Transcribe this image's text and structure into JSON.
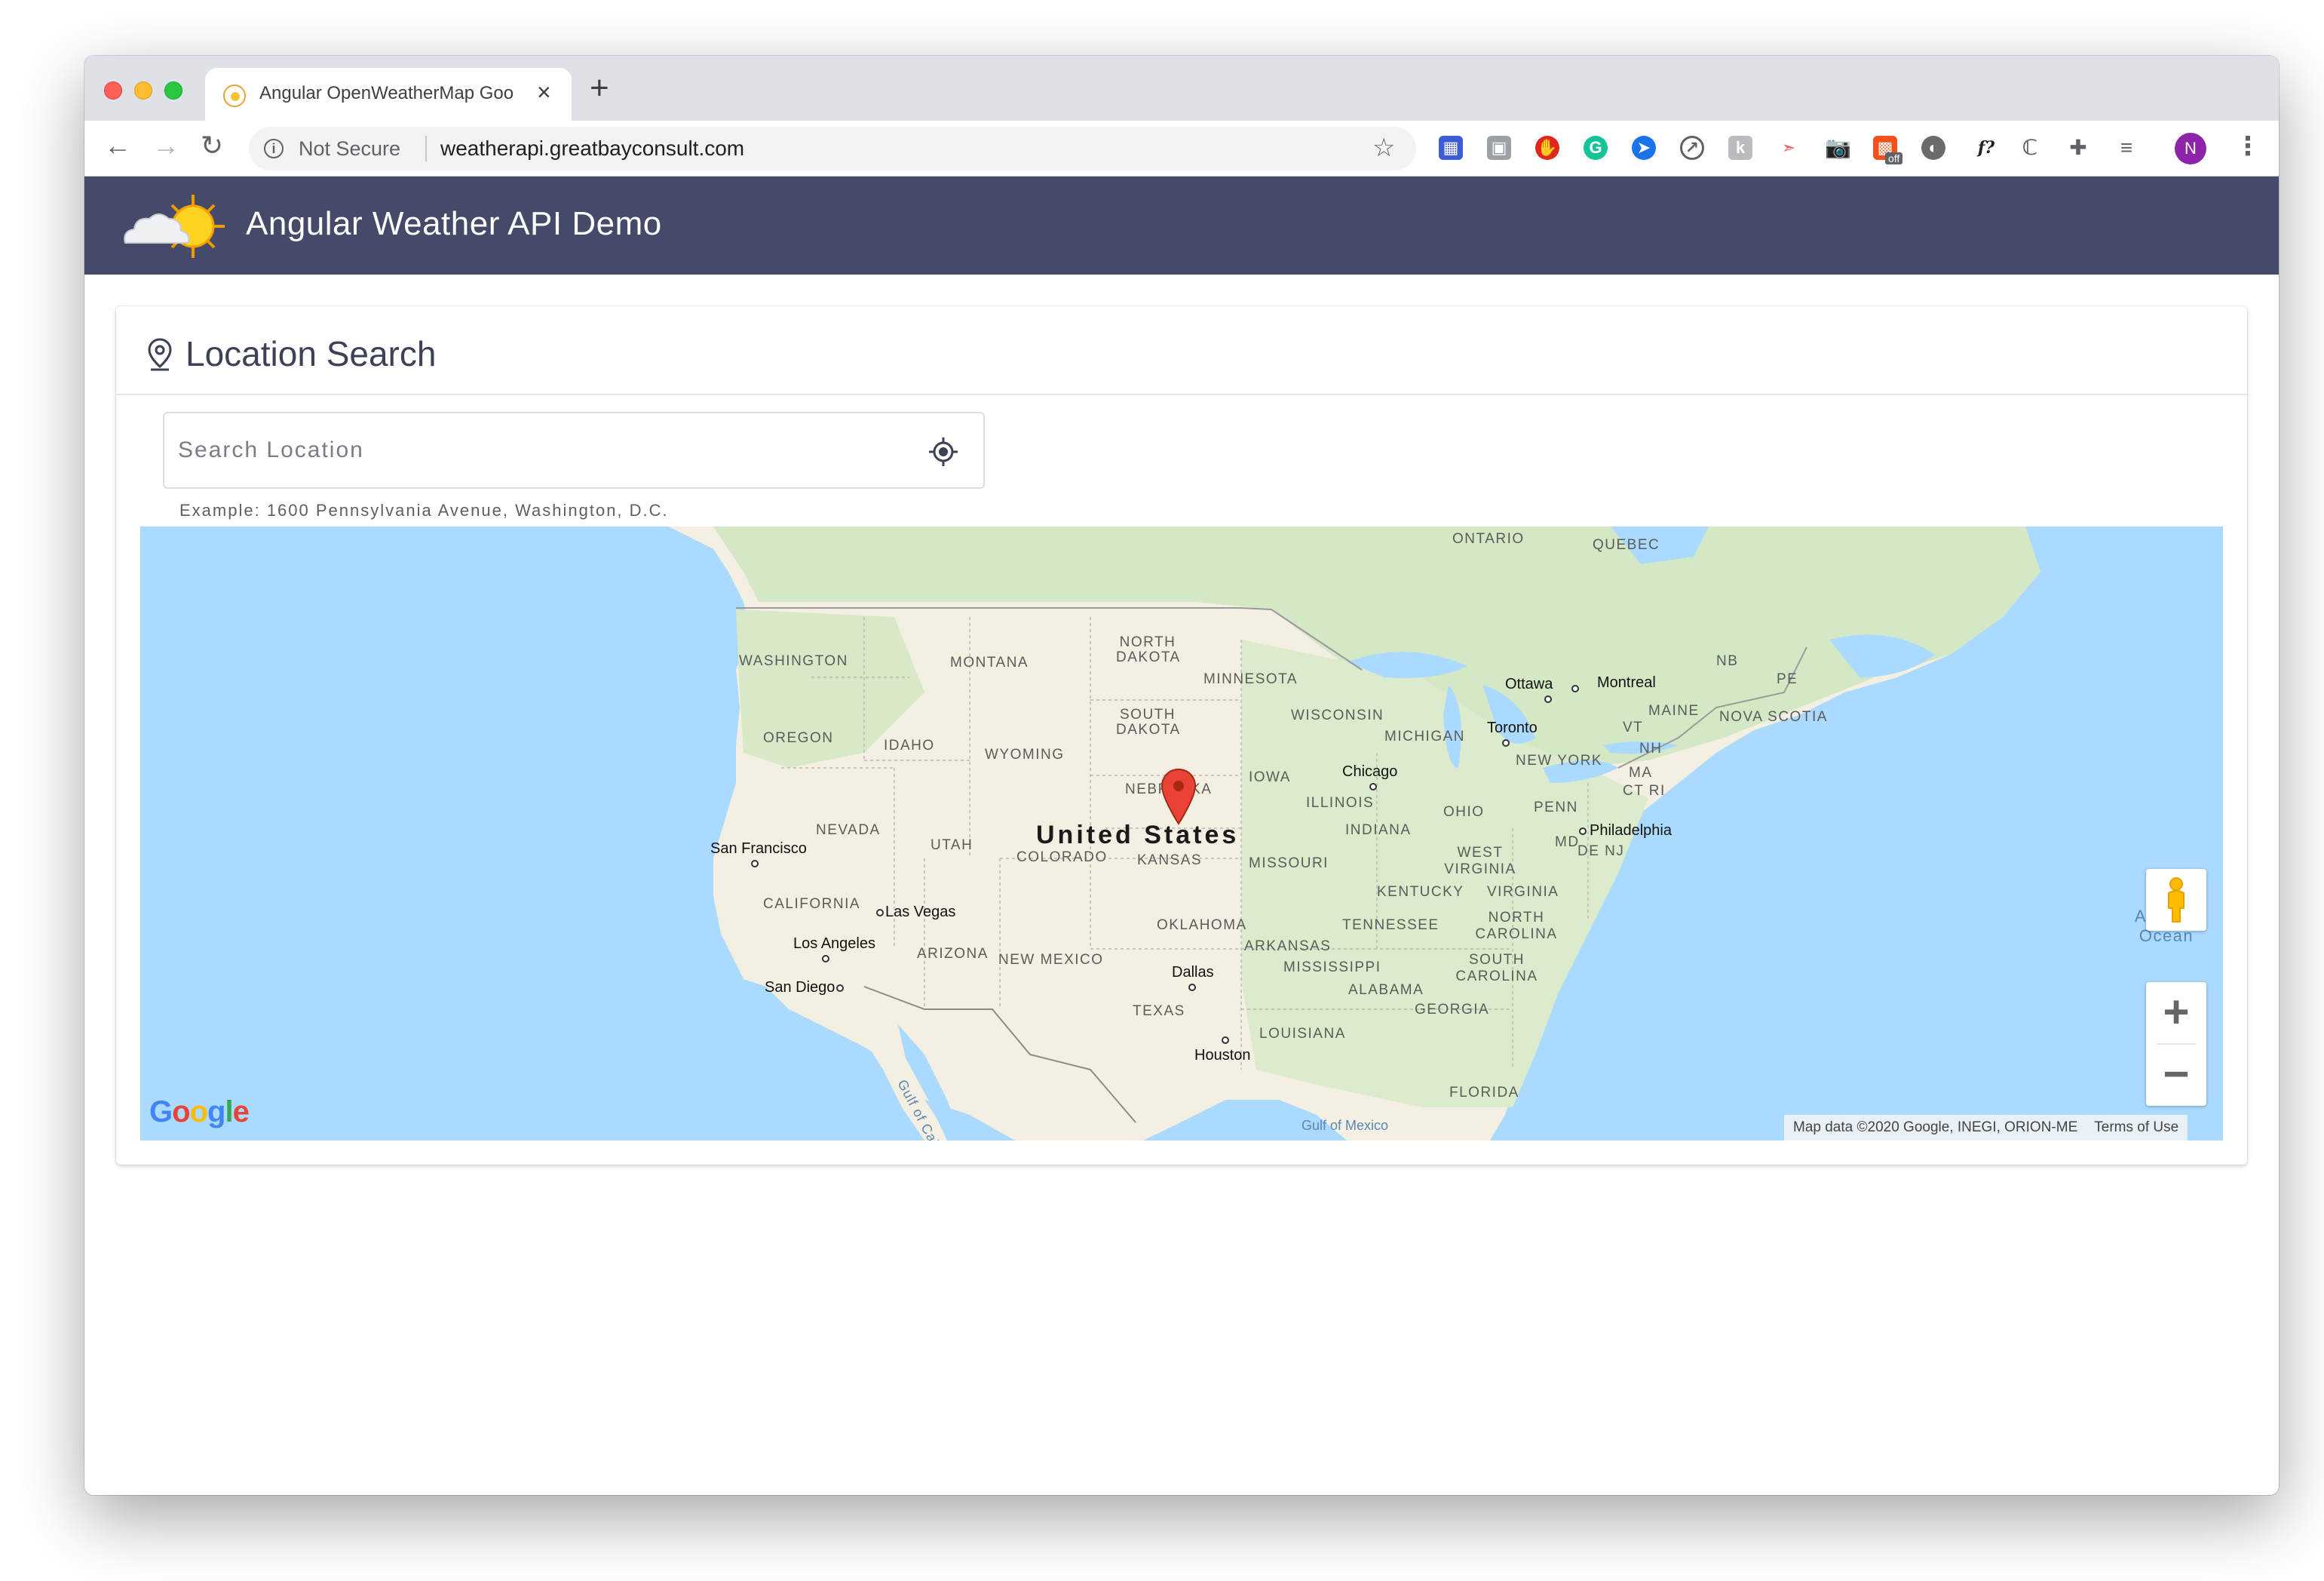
{
  "browser": {
    "tab_title": "Angular OpenWeatherMap Goo",
    "new_tab": "+",
    "close": "×",
    "security": "Not Secure",
    "url": "weatherapi.greatbayconsult.com",
    "avatar_initial": "N",
    "extension_off_badge": "off",
    "extension_f_label": "f?"
  },
  "app": {
    "title": "Angular Weather API Demo"
  },
  "card": {
    "title": "Location Search",
    "search_placeholder": "Search Location",
    "search_value": "",
    "hint": "Example: 1600 Pennsylvania Avenue, Washington, D.C."
  },
  "map": {
    "country": "United States",
    "regions": [
      "ONTARIO",
      "QUEBEC",
      "WASHINGTON",
      "MONTANA",
      "NORTH DAKOTA",
      "MINNESOTA",
      "OREGON",
      "IDAHO",
      "SOUTH DAKOTA",
      "WYOMING",
      "WISCONSIN",
      "MICHIGAN",
      "NEBRASKA",
      "IOWA",
      "NEVADA",
      "UTAH",
      "COLORADO",
      "KANSAS",
      "ILLINOIS",
      "INDIANA",
      "OHIO",
      "PENN",
      "CALIFORNIA",
      "MISSOURI",
      "WEST VIRGINIA",
      "VIRGINIA",
      "KENTUCKY",
      "ARIZONA",
      "NEW MEXICO",
      "OKLAHOMA",
      "TENNESSEE",
      "NORTH CAROLINA",
      "ARKANSAS",
      "MISSISSIPPI",
      "SOUTH CAROLINA",
      "ALABAMA",
      "GEORGIA",
      "TEXAS",
      "LOUISIANA",
      "FLORIDA",
      "NEW YORK",
      "MAINE",
      "NOVA SCOTIA",
      "NB",
      "PE",
      "VT",
      "NH",
      "MA",
      "CT RI",
      "MD",
      "DE NJ"
    ],
    "cities": [
      "Ottawa",
      "Montreal",
      "Toronto",
      "Chicago",
      "Philadelphia",
      "San Francisco",
      "Las Vegas",
      "Los Angeles",
      "San Diego",
      "Dallas",
      "Houston"
    ],
    "water": [
      "Atlantic Ocean",
      "Gulf of California",
      "Gulf of Mexico"
    ],
    "google_logo": "Google",
    "attribution": "Map data ©2020 Google, INEGI, ORION-ME",
    "terms": "Terms of Use",
    "zoom_in": "+",
    "zoom_out": "−"
  },
  "colors": {
    "app_header": "#454a68",
    "marker": "#ea4335",
    "water": "#aadaff",
    "land": "#f2efe4",
    "forest": "#cfe6c2"
  }
}
